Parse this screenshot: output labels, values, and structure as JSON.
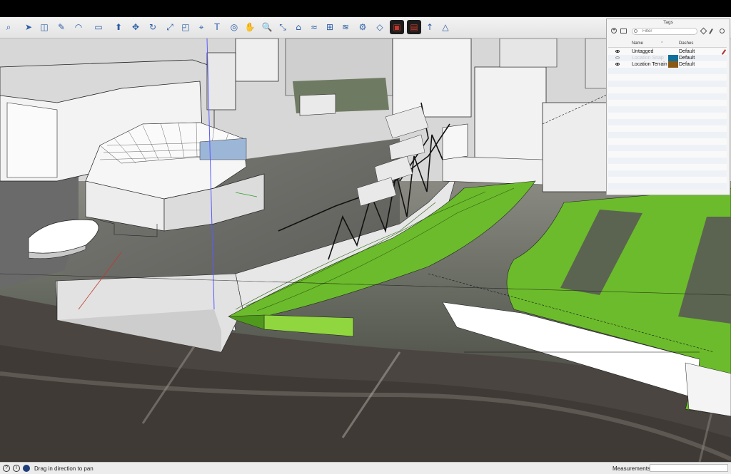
{
  "toolbar": {
    "icons": [
      "search-icon",
      "select-arrow-icon",
      "eraser-icon",
      "pencil-line-icon",
      "arc-icon",
      "rectangle-icon",
      "push-pull-icon",
      "move-icon",
      "rotate-icon",
      "scale-icon",
      "offset-icon",
      "tape-measure-icon",
      "text-icon",
      "orbit-icon",
      "pan-icon",
      "zoom-icon",
      "zoom-extents-icon",
      "sandbox-icon",
      "smoove-icon",
      "stamp-icon",
      "drape-icon",
      "add-detail-icon",
      "flip-edge-icon",
      "warehouse-icon",
      "extension-warehouse-icon",
      "send-to-layout-icon",
      "section-plane-icon"
    ]
  },
  "tags_panel": {
    "title": "Tags",
    "filter_placeholder": "Filter",
    "columns": {
      "name": "Name",
      "dashes": "Dashes"
    },
    "rows": [
      {
        "name": "Untagged",
        "visible": true,
        "color": "",
        "dashes": "Default",
        "dim": false
      },
      {
        "name": "Location Snap",
        "visible": false,
        "color": "#0d6f9a",
        "dashes": "Default",
        "dim": true
      },
      {
        "name": "Location Terrain",
        "visible": true,
        "color": "#8a5a12",
        "dashes": "Default",
        "dim": false
      }
    ]
  },
  "statusbar": {
    "hint": "Drag in direction to pan",
    "measurements_label": "Measurements",
    "measurements_value": ""
  },
  "scene": {
    "colors": {
      "green": "#6cbb2c",
      "green_dark": "#4f9a1c",
      "green_light": "#8fd63f",
      "building": "#f2f2f2",
      "shadow": "#9a9a9a"
    }
  }
}
